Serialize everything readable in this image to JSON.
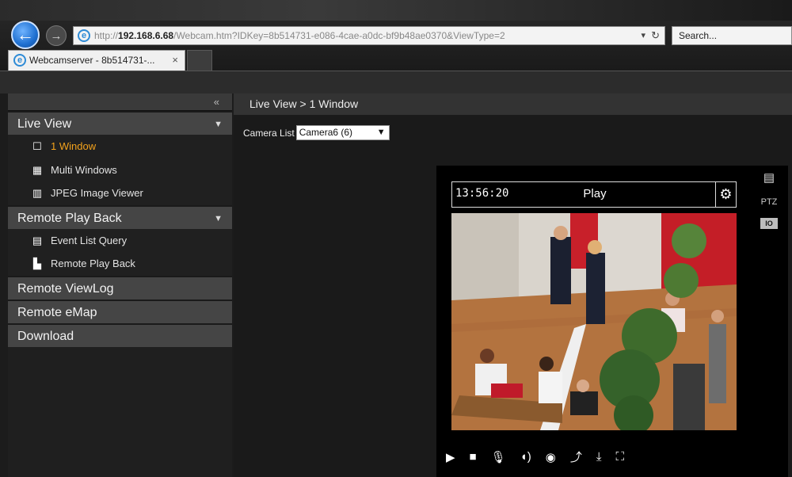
{
  "browser": {
    "back_glyph": "←",
    "forward_glyph": "→",
    "url_prefix": "http://",
    "url_host": "192.168.6.68",
    "url_rest": "/Webcam.htm?IDKey=8b514731-e086-4cae-a0dc-bf9b48ae0370&ViewType=2",
    "search_placeholder": "Search...",
    "tab_title": "Webcamserver - 8b514731-...",
    "tab_close": "×"
  },
  "sidebar": {
    "collapse_glyph": "«",
    "sections": {
      "live_view": "Live View",
      "remote_play_back": "Remote Play Back",
      "remote_viewlog": "Remote ViewLog",
      "remote_emap": "Remote eMap",
      "download": "Download"
    },
    "live_items": [
      "1 Window",
      "Multi Windows",
      "JPEG Image Viewer"
    ],
    "playback_items": [
      "Event List Query",
      "Remote Play Back"
    ]
  },
  "content": {
    "breadcrumb": "Live View > 1 Window",
    "camera_list_label": "Camera List",
    "camera_selected": "Camera6 (6)"
  },
  "player": {
    "time": "13:56:20",
    "state": "Play",
    "ptz_label": "PTZ",
    "io_label": "IO"
  },
  "colors": {
    "accent_active": "#f3a21c",
    "ie_blue": "#1e6fd0"
  }
}
